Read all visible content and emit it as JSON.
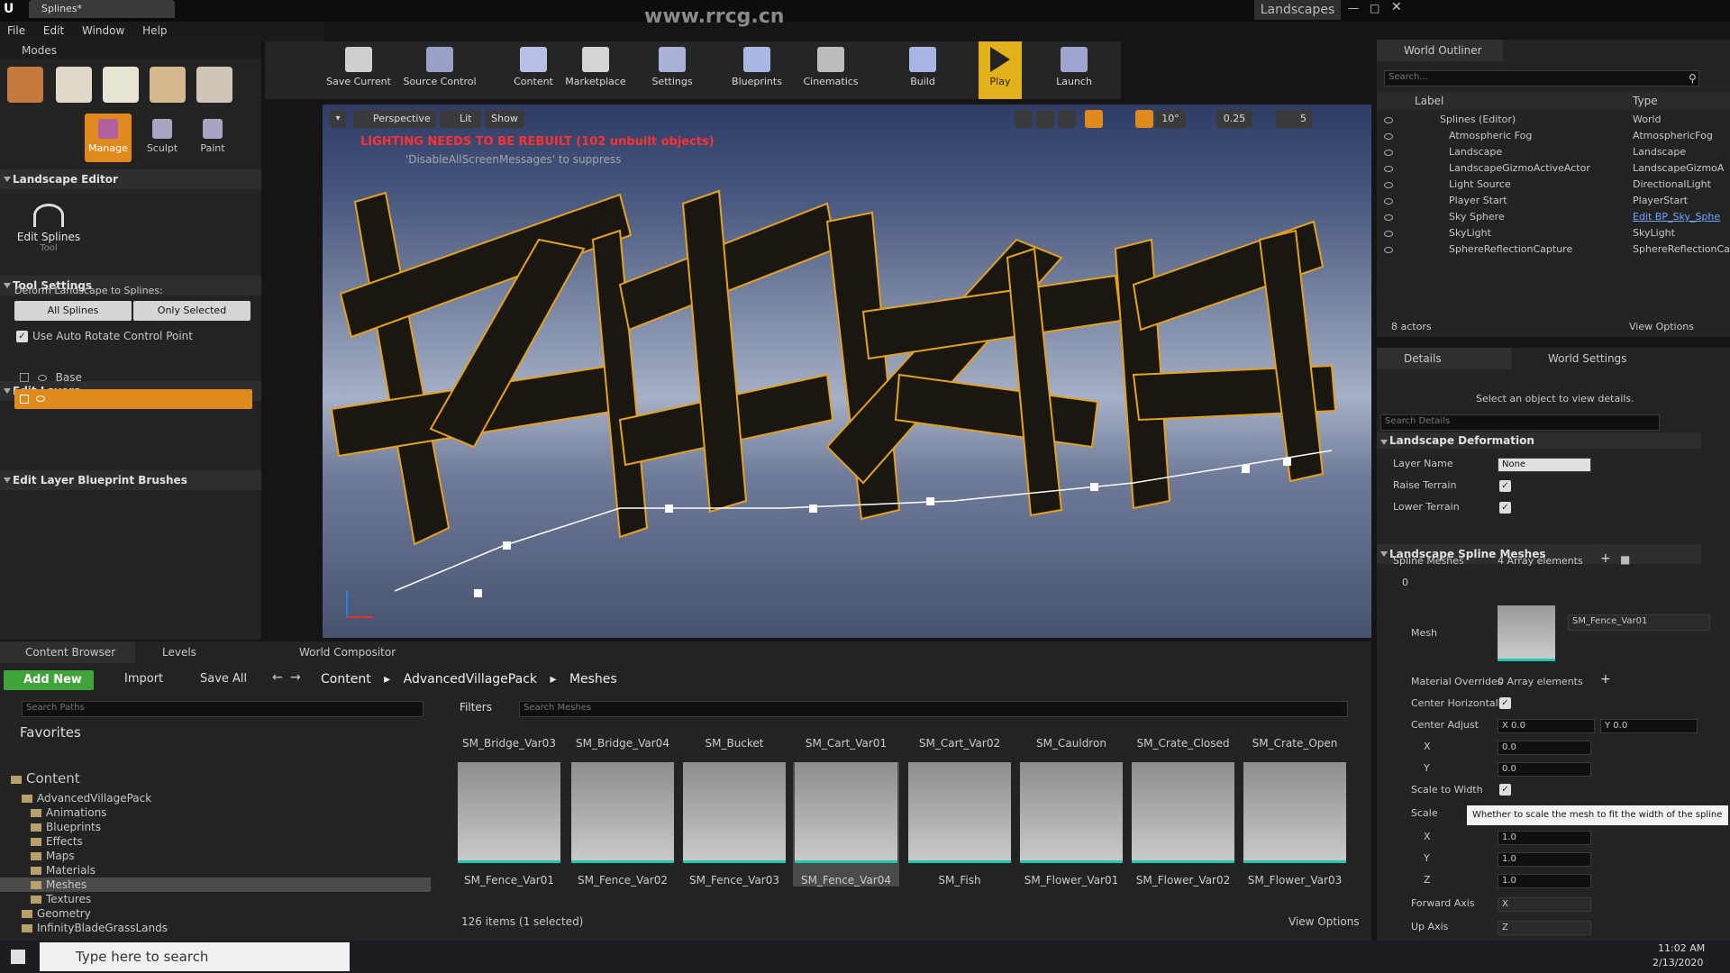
{
  "window": {
    "tab_title": "Splines*",
    "project_name": "Landscapes",
    "watermark": "www.rrcg.cn"
  },
  "menu": [
    "File",
    "Edit",
    "Window",
    "Help"
  ],
  "modes": {
    "title": "Modes",
    "labels": [
      "Manage",
      "Sculpt",
      "Paint"
    ]
  },
  "landscape_editor": {
    "title": "Landscape Editor",
    "tool_label": "Edit Splines",
    "tool_sub": "Tool",
    "tool_settings": "Tool Settings",
    "deform_label": "Deform Landscape to Splines:",
    "all_splines": "All Splines",
    "only_selected": "Only Selected",
    "auto_rotate": "Use Auto Rotate Control Point",
    "edit_layers": "Edit Layers",
    "layers": [
      "Base"
    ],
    "blueprint_brushes": "Edit Layer Blueprint Brushes"
  },
  "toolbar": [
    "Save Current",
    "Source Control",
    "Content",
    "Marketplace",
    "Settings",
    "Blueprints",
    "Cinematics",
    "Build",
    "Play",
    "Launch"
  ],
  "viewport": {
    "perspective": "Perspective",
    "lit": "Lit",
    "show": "Show",
    "warning": "LIGHTING NEEDS TO BE REBUILT (102 unbuilt objects)",
    "suppress": "'DisableAllScreenMessages' to suppress",
    "snap_angle": "10°",
    "snap_scale": "0.25",
    "cam_speed": "5"
  },
  "outliner": {
    "title": "World Outliner",
    "search_placeholder": "Search...",
    "col_label": "Label",
    "col_type": "Type",
    "rows": [
      {
        "label": "Splines (Editor)",
        "type": "World"
      },
      {
        "label": "Atmospheric Fog",
        "type": "AtmosphericFog"
      },
      {
        "label": "Landscape",
        "type": "Landscape"
      },
      {
        "label": "LandscapeGizmoActiveActor",
        "type": "LandscapeGizmoA"
      },
      {
        "label": "Light Source",
        "type": "DirectionalLight"
      },
      {
        "label": "Player Start",
        "type": "PlayerStart"
      },
      {
        "label": "Sky Sphere",
        "type": "Edit BP_Sky_Sphe"
      },
      {
        "label": "SkyLight",
        "type": "SkyLight"
      },
      {
        "label": "SphereReflectionCapture",
        "type": "SphereReflectionCa"
      }
    ],
    "count": "8 actors",
    "view_options": "View Options"
  },
  "details": {
    "tab_details": "Details",
    "tab_world": "World Settings",
    "hint": "Select an object to view details.",
    "search_placeholder": "Search Details",
    "section_deform": "Landscape Deformation",
    "layer_name_label": "Layer Name",
    "layer_name_value": "None",
    "raise_terrain": "Raise Terrain",
    "lower_terrain": "Lower Terrain",
    "section_meshes": "Landscape Spline Meshes",
    "spline_meshes": "Spline Meshes",
    "array_count": "4 Array elements",
    "index0": "0",
    "mesh_label": "Mesh",
    "mesh_value": "SM_Fence_Var01",
    "material_overrides": "Material Overrides",
    "mat_count": "0 Array elements",
    "center_h": "Center Horizontally",
    "center_adjust": "Center Adjust",
    "ca_x": "X 0.0",
    "ca_y": "Y 0.0",
    "x_label": "X",
    "y_label": "Y",
    "z_label": "Z",
    "ca_x_val": "0.0",
    "ca_y_val": "0.0",
    "scale_to_width": "Scale to Width",
    "tooltip": "Whether to scale the mesh to fit the width of the spline",
    "scale": "Scale",
    "sx": "1.0",
    "sy": "1.0",
    "sz": "1.0",
    "forward_axis": "Forward Axis",
    "forward_val": "X",
    "up_axis": "Up Axis",
    "up_val": "Z"
  },
  "content_browser": {
    "tabs": [
      "Content Browser",
      "Levels",
      "World Compositor"
    ],
    "add_new": "Add New",
    "import": "Import",
    "save_all": "Save All",
    "path": [
      "Content",
      "AdvancedVillagePack",
      "Meshes"
    ],
    "search_paths": "Search Paths",
    "filters": "Filters",
    "search_meshes": "Search Meshes",
    "favorites": "Favorites",
    "tree": [
      {
        "label": "Content",
        "level": 0
      },
      {
        "label": "AdvancedVillagePack",
        "level": 1
      },
      {
        "label": "Animations",
        "level": 2
      },
      {
        "label": "Blueprints",
        "level": 2
      },
      {
        "label": "Effects",
        "level": 2
      },
      {
        "label": "Maps",
        "level": 2
      },
      {
        "label": "Materials",
        "level": 2
      },
      {
        "label": "Meshes",
        "level": 2
      },
      {
        "label": "Textures",
        "level": 2
      },
      {
        "label": "Geometry",
        "level": 1
      },
      {
        "label": "InfinityBladeGrassLands",
        "level": 1
      }
    ],
    "top_row": [
      "SM_Bridge_Var03",
      "SM_Bridge_Var04",
      "SM_Bucket",
      "SM_Cart_Var01",
      "SM_Cart_Var02",
      "SM_Cauldron",
      "SM_Crate_Closed",
      "SM_Crate_Open"
    ],
    "assets": [
      "SM_Fence_Var01",
      "SM_Fence_Var02",
      "SM_Fence_Var03",
      "SM_Fence_Var04",
      "SM_Fish",
      "SM_Flower_Var01",
      "SM_Flower_Var02",
      "SM_Flower_Var03"
    ],
    "status": "126 items (1 selected)",
    "view_options": "View Options"
  },
  "taskbar": {
    "search": "Type here to search",
    "time": "11:02 AM",
    "date": "2/13/2020"
  }
}
